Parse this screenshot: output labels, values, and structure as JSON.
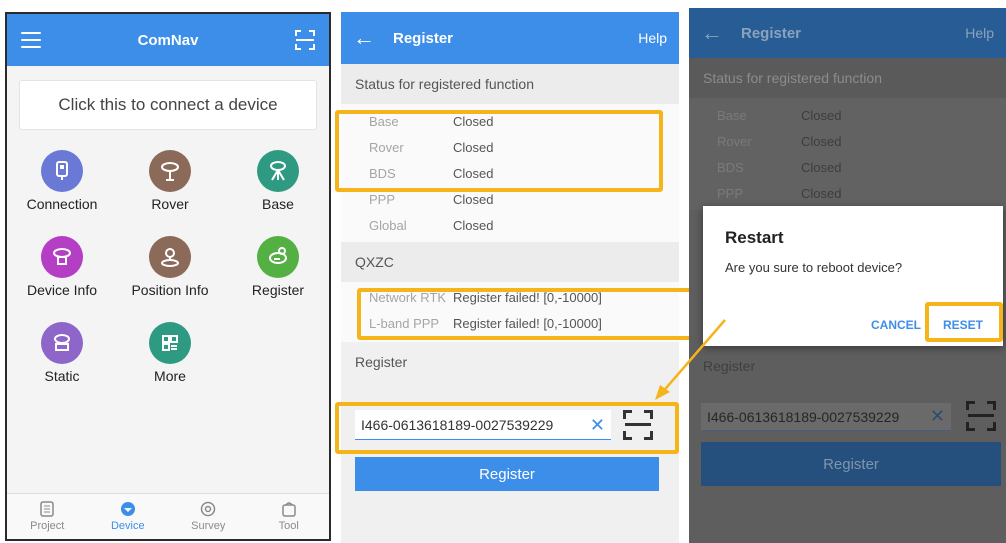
{
  "colors": {
    "primary": "#3d8ee8",
    "highlight": "#f5b41a",
    "connection": "#6a78d6",
    "rover": "#8b6a5a",
    "base": "#2f9a82",
    "device_info": "#b43ec4",
    "position_info": "#8b6a5a",
    "register": "#55b043",
    "static": "#8e65c8",
    "more": "#2f9a82"
  },
  "home": {
    "title": "ComNav",
    "connect_prompt": "Click this to connect a device",
    "tiles": [
      {
        "label": "Connection",
        "icon": "connection-icon"
      },
      {
        "label": "Rover",
        "icon": "rover-icon"
      },
      {
        "label": "Base",
        "icon": "base-icon"
      },
      {
        "label": "Device Info",
        "icon": "device-info-icon"
      },
      {
        "label": "Position Info",
        "icon": "position-info-icon"
      },
      {
        "label": "Register",
        "icon": "register-icon"
      },
      {
        "label": "Static",
        "icon": "static-icon"
      },
      {
        "label": "More",
        "icon": "more-icon"
      }
    ],
    "tabs": [
      {
        "label": "Project",
        "icon": "project-icon"
      },
      {
        "label": "Device",
        "icon": "device-icon"
      },
      {
        "label": "Survey",
        "icon": "survey-icon"
      },
      {
        "label": "Tool",
        "icon": "tool-icon"
      }
    ]
  },
  "register": {
    "back": "←",
    "title": "Register",
    "help": "Help",
    "status_header": "Status for registered function",
    "functions": [
      {
        "name": "Base",
        "status": "Closed"
      },
      {
        "name": "Rover",
        "status": "Closed"
      },
      {
        "name": "BDS",
        "status": "Closed"
      },
      {
        "name": "PPP",
        "status": "Closed"
      },
      {
        "name": "Global",
        "status": "Closed"
      }
    ],
    "qxzc_header": "QXZC",
    "qxzc": [
      {
        "name": "Network RTK",
        "status": "Register failed! [0,-10000]"
      },
      {
        "name": "L-band PPP",
        "status": "Register failed! [0,-10000]"
      }
    ],
    "register_header": "Register",
    "code_value": "I466-0613618189-0027539229",
    "clear": "✕",
    "button": "Register"
  },
  "restart": {
    "back": "←",
    "title": "Register",
    "help": "Help",
    "status_header": "Status for registered function",
    "functions": [
      {
        "name": "Base",
        "status": "Closed"
      },
      {
        "name": "Rover",
        "status": "Closed"
      },
      {
        "name": "BDS",
        "status": "Closed"
      },
      {
        "name": "PPP",
        "status": "Closed"
      }
    ],
    "register_header": "Register",
    "code_value": "I466-0613618189-0027539229",
    "clear": "✕",
    "button": "Register",
    "dialog_title": "Restart",
    "dialog_message": "Are you sure to reboot device?",
    "cancel": "CANCEL",
    "reset": "RESET"
  }
}
